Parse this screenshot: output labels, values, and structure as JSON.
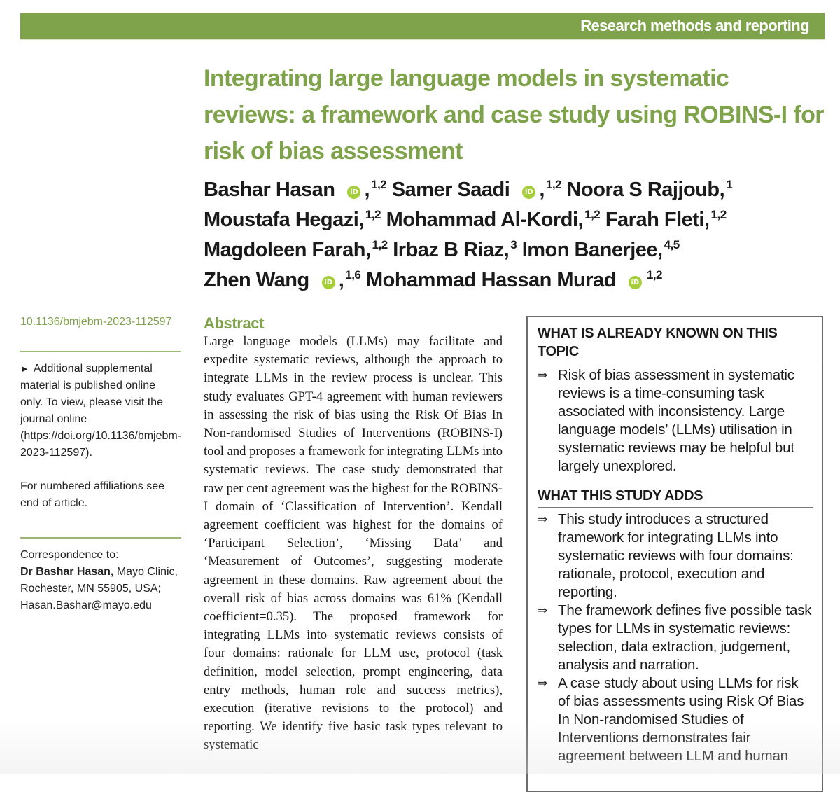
{
  "banner": {
    "section": "Research methods and reporting"
  },
  "article": {
    "title": "Integrating large language models in systematic reviews: a framework and case study using ROBINS-I for risk of bias assessment",
    "authors": [
      {
        "name": "Bashar Hasan",
        "orcid": true,
        "affiliations": "1,2"
      },
      {
        "name": "Samer Saadi",
        "orcid": true,
        "affiliations": "1,2"
      },
      {
        "name": "Noora S Rajjoub,",
        "orcid": false,
        "affiliations": "1"
      },
      {
        "name": "Moustafa Hegazi,",
        "orcid": false,
        "affiliations": "1,2"
      },
      {
        "name": "Mohammad Al-Kordi,",
        "orcid": false,
        "affiliations": "1,2"
      },
      {
        "name": "Farah Fleti,",
        "orcid": false,
        "affiliations": "1,2"
      },
      {
        "name": "Magdoleen Farah,",
        "orcid": false,
        "affiliations": "1,2"
      },
      {
        "name": "Irbaz B Riaz,",
        "orcid": false,
        "affiliations": "3"
      },
      {
        "name": "Imon Banerjee,",
        "orcid": false,
        "affiliations": "4,5"
      },
      {
        "name": "Zhen Wang",
        "orcid": true,
        "affiliations": "1,6"
      },
      {
        "name": "Mohammad Hassan Murad",
        "orcid": true,
        "affiliations": "1,2"
      }
    ],
    "orcid_icon_label": "iD",
    "orcid_comma": ","
  },
  "sidebar": {
    "doi": "10.1136/bmjebm-2023-112597",
    "supplemental_marker": "►",
    "supplemental": "Additional supplemental material is published online only. To view, please visit the journal online (https://doi.org/10.1136/bmjebm-2023-112597).",
    "affiliations_note": "For numbered affiliations see end of article.",
    "correspondence_label": "Correspondence to:",
    "correspondence_name": "Dr Bashar Hasan,",
    "correspondence_address": " Mayo Clinic, Rochester, MN 55905, USA;",
    "correspondence_email": "Hasan.Bashar@mayo.edu"
  },
  "abstract": {
    "heading": "Abstract",
    "body": "Large language models (LLMs) may facilitate and expedite systematic reviews, although the approach to integrate LLMs in the review process is unclear. This study evaluates GPT-4 agreement with human reviewers in assessing the risk of bias using the Risk Of Bias In Non-randomised Studies of Interventions (ROBINS-I) tool and proposes a framework for integrating LLMs into systematic reviews. The case study demonstrated that raw per cent agreement was the highest for the ROBINS-I domain of ‘Classification of Intervention’. Kendall agreement coefficient was highest for the domains of ‘Participant Selection’, ‘Missing Data’ and ‘Measurement of Outcomes’, suggesting moderate agreement in these domains. Raw agreement about the overall risk of bias across domains was 61% (Kendall coefficient=0.35). The proposed framework for integrating LLMs into systematic reviews consists of four domains: rationale for LLM use, protocol (task definition, model selection, prompt engineering, data entry methods, human role and success metrics), execution (iterative revisions to the protocol) and reporting. We identify five basic task types relevant to systematic"
  },
  "keybox": {
    "arrow": "⇒",
    "known_heading": "WHAT IS ALREADY KNOWN ON THIS TOPIC",
    "known_items": [
      "Risk of bias assessment in systematic reviews is a time-consuming task associated with inconsistency. Large language models’ (LLMs) utilisation in systematic reviews may be helpful but largely unexplored."
    ],
    "adds_heading": "WHAT THIS STUDY ADDS",
    "adds_items": [
      "This study introduces a structured framework for integrating LLMs into systematic reviews with four domains: rationale, protocol, execution and reporting.",
      "The framework defines five possible task types for LLMs in systematic reviews: selection, data extraction, judgement, analysis and narration.",
      "A case study about using LLMs for risk of bias assessments using Risk Of Bias In Non-randomised Studies of Interventions demonstrates fair agreement between LLM and human"
    ]
  },
  "colors": {
    "brand_green": "#7fa34b",
    "orcid_green": "#a6ce39",
    "box_border": "#6b6b6b"
  }
}
